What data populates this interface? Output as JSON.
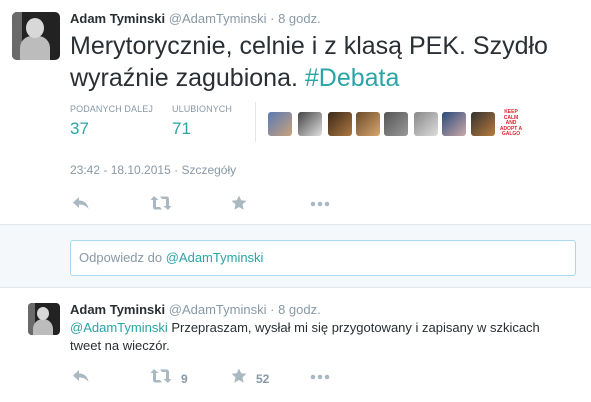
{
  "main_tweet": {
    "author_name": "Adam Tyminski",
    "author_handle": "@AdamTyminski",
    "separator": "·",
    "time_ago": "8 godz.",
    "text": "Merytorycznie, celnie i z klasą PEK. Szydło wyraźnie zagubiona. ",
    "hashtag": "#Debata",
    "retweets_label": "PODANYCH DALEJ",
    "retweets_count": "37",
    "favorites_label": "ULUBIONYCH",
    "favorites_count": "71",
    "keep_calm_text": "KEEP CALM AND ADOPT A GALGO",
    "datetime": "23:42 - 18.10.2015",
    "datetime_sep": "·",
    "details_link": "Szczegóły",
    "actions": [
      "reply-icon",
      "retweet-icon",
      "favorite-icon",
      "more-icon"
    ]
  },
  "reply_box": {
    "placeholder_prefix": "Odpowiedz do ",
    "mention": "@AdamTyminski"
  },
  "reply_tweet": {
    "author_name": "Adam Tyminski",
    "author_handle": "@AdamTyminski",
    "separator": "·",
    "time_ago": "8 godz.",
    "mention": "@AdamTyminski",
    "text": " Przepraszam, wysłał mi się przygotowany i zapisany w szkicach tweet na wieczór.",
    "retweets_count": "9",
    "favorites_count": "52"
  },
  "colors": {
    "accent": "#2aa4a6",
    "muted": "#8899a6",
    "text": "#292f33",
    "action_icon": "#aab8c2"
  }
}
